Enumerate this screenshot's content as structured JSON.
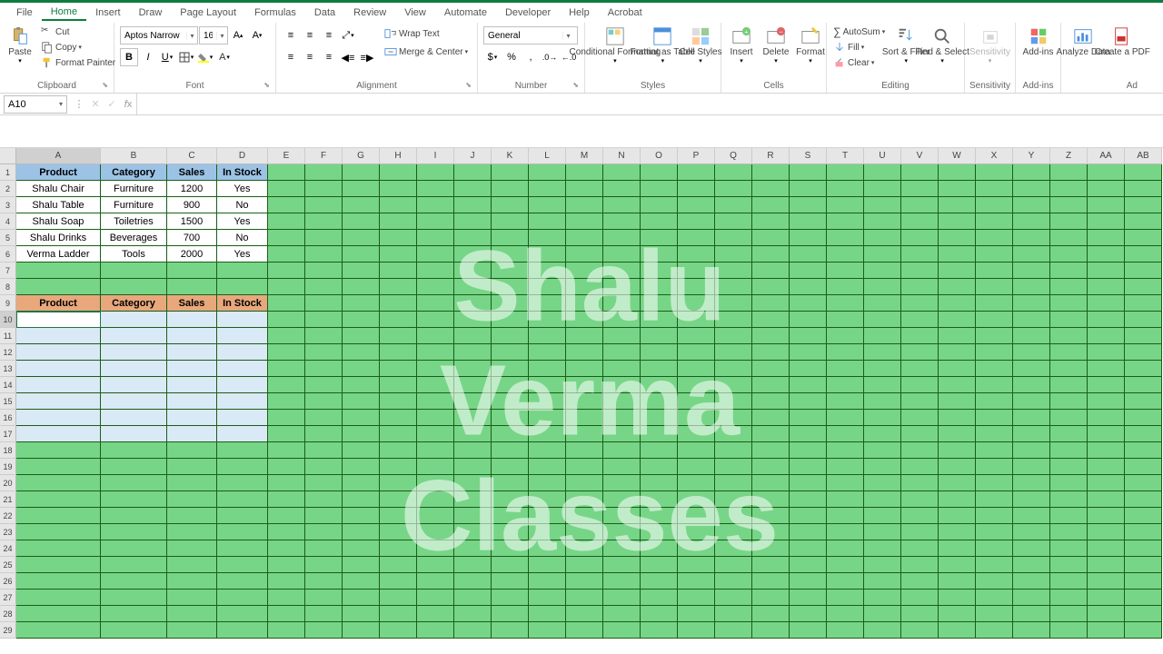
{
  "menu": [
    "File",
    "Home",
    "Insert",
    "Draw",
    "Page Layout",
    "Formulas",
    "Data",
    "Review",
    "View",
    "Automate",
    "Developer",
    "Help",
    "Acrobat"
  ],
  "menu_active": 1,
  "ribbon": {
    "clipboard": {
      "paste": "Paste",
      "cut": "Cut",
      "copy": "Copy",
      "painter": "Format Painter",
      "label": "Clipboard"
    },
    "font": {
      "name": "Aptos Narrow",
      "size": "16",
      "label": "Font"
    },
    "alignment": {
      "wrap": "Wrap Text",
      "merge": "Merge & Center",
      "label": "Alignment"
    },
    "number": {
      "format": "General",
      "label": "Number"
    },
    "styles": {
      "cond": "Conditional\nFormatting",
      "table": "Format as\nTable",
      "cell": "Cell\nStyles",
      "label": "Styles"
    },
    "cells": {
      "insert": "Insert",
      "delete": "Delete",
      "format": "Format",
      "label": "Cells"
    },
    "editing": {
      "sum": "AutoSum",
      "fill": "Fill",
      "clear": "Clear",
      "sort": "Sort &\nFilter",
      "find": "Find &\nSelect",
      "label": "Editing"
    },
    "sensitivity": {
      "btn": "Sensitivity",
      "label": "Sensitivity"
    },
    "addins": {
      "btn": "Add-ins",
      "label": "Add-ins"
    },
    "analyze": {
      "btn": "Analyze\nData"
    },
    "pdf": {
      "btn": "Create\na PDF"
    },
    "ad_label": "Ad"
  },
  "namebox": "A10",
  "columns": [
    "A",
    "B",
    "C",
    "D",
    "E",
    "F",
    "G",
    "H",
    "I",
    "J",
    "K",
    "L",
    "M",
    "N",
    "O",
    "P",
    "Q",
    "R",
    "S",
    "T",
    "U",
    "V",
    "W",
    "X",
    "Y",
    "Z",
    "AA",
    "AB"
  ],
  "col_widths": {
    "A": 93,
    "B": 73,
    "C": 55,
    "D": 56,
    "default": 41
  },
  "row_count": 29,
  "headers1": [
    "Product",
    "Category",
    "Sales",
    "In Stock"
  ],
  "data_rows": [
    [
      "Shalu Chair",
      "Furniture",
      "1200",
      "Yes"
    ],
    [
      "Shalu Table",
      "Furniture",
      "900",
      "No"
    ],
    [
      "Shalu Soap",
      "Toiletries",
      "1500",
      "Yes"
    ],
    [
      "Shalu Drinks",
      "Beverages",
      "700",
      "No"
    ],
    [
      "Verma Ladder",
      "Tools",
      "2000",
      "Yes"
    ]
  ],
  "headers2_row": 9,
  "headers2": [
    "Product",
    "Category",
    "Sales",
    "In Stock"
  ],
  "blue_rows": [
    10,
    11,
    12,
    13,
    14,
    15,
    16,
    17
  ],
  "colors": {
    "green": "#77d587",
    "header_blue": "#9cc3e6",
    "header_orange": "#e8a87c",
    "pale_blue": "#d9e9f5"
  },
  "watermark": "Shalu Verma\nClasses",
  "active_cell": {
    "row": 10,
    "col": 0
  }
}
